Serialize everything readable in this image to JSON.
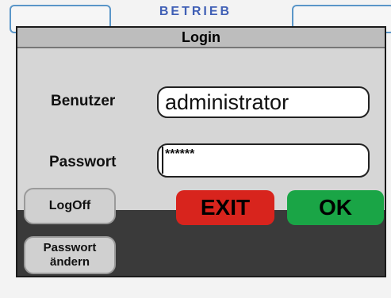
{
  "background": {
    "title": "BETRIEB"
  },
  "dialog": {
    "title": "Login",
    "user_label": "Benutzer",
    "user_value": "administrator",
    "password_label": "Passwort",
    "password_value": "******",
    "logoff_label": "LogOff",
    "change_password_line1": "Passwort",
    "change_password_line2": "ändern",
    "exit_label": "EXIT",
    "ok_label": "OK"
  },
  "colors": {
    "exit": "#d8241d",
    "ok": "#1aa546",
    "dialog_bg": "#3a3a3a",
    "form_bg": "#d6d6d6"
  }
}
